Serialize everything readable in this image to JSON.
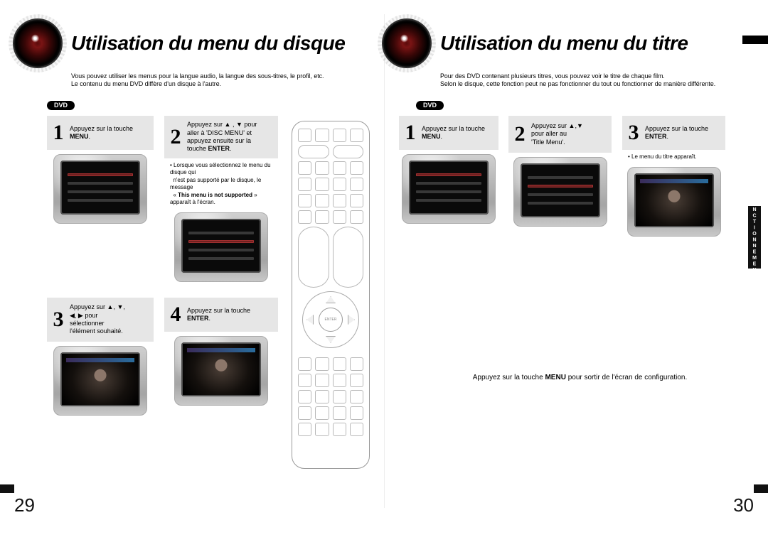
{
  "left": {
    "title": "Utilisation du menu du disque",
    "subtitle_line1": "Vous pouvez utiliser les menus pour la langue audio, la langue des sous-titres, le profil, etc.",
    "subtitle_line2": "Le contenu du menu DVD diffère d'un disque à l'autre.",
    "dvd_badge": "DVD",
    "steps": {
      "s1": {
        "num": "1",
        "text_prefix": "Appuyez sur la touche ",
        "bold": "MENU",
        "suffix": "."
      },
      "s2": {
        "num": "2",
        "line1_prefix": "Appuyez sur ",
        "line1_icons": "▲ , ▼",
        "line1_suffix": " pour",
        "line2": "aller à 'DISC MENU' et",
        "line3": "appuyez ensuite sur la",
        "line4_prefix": "touche ",
        "line4_bold": "ENTER",
        "line4_suffix": ".",
        "note_bullet": "•",
        "note_l1": "Lorsque vous sélectionnez le menu du disque qui",
        "note_l2": "n'est pas supporté par le disque, le message",
        "note_l3_prefix": "« ",
        "note_l3_bold": "This menu is not supported",
        "note_l3_suffix": " » apparaît à l'écran."
      },
      "s3": {
        "num": "3",
        "line1_prefix": "Appuyez sur ",
        "line1_icons": "▲, ▼,",
        "line2_icons": "◀, ▶ ",
        "line2": "pour",
        "line3": "sélectionner",
        "line4": "l'élément souhaité."
      },
      "s4": {
        "num": "4",
        "text_prefix": "Appuyez sur la touche ",
        "bold": "ENTER",
        "suffix": "."
      }
    },
    "page_number": "29"
  },
  "right": {
    "title": "Utilisation du menu du titre",
    "subtitle_line1": "Pour des DVD contenant plusieurs titres, vous pouvez voir le titre de chaque film.",
    "subtitle_line2": "Selon le disque, cette fonction peut ne pas fonctionner du tout ou fonctionner de manière différente.",
    "dvd_badge": "DVD",
    "steps": {
      "s1": {
        "num": "1",
        "text_prefix": "Appuyez sur la touche ",
        "bold": "MENU",
        "suffix": "."
      },
      "s2": {
        "num": "2",
        "line1_prefix": "Appuyez sur ",
        "line1_icons": "▲,▼",
        "line2": "pour aller au",
        "line3": "'Title Menu'."
      },
      "s3": {
        "num": "3",
        "text_prefix": "Appuyez sur la touche ",
        "bold": "ENTER",
        "suffix": ".",
        "note_bullet": "•",
        "note": "Le menu du titre apparaît."
      }
    },
    "exit_note_prefix": "Appuyez sur la touche ",
    "exit_note_bold": "MENU",
    "exit_note_suffix": " pour sortir de l'écran de configuration.",
    "section_tab": "FONCTIONNEMENT",
    "page_number": "30"
  }
}
